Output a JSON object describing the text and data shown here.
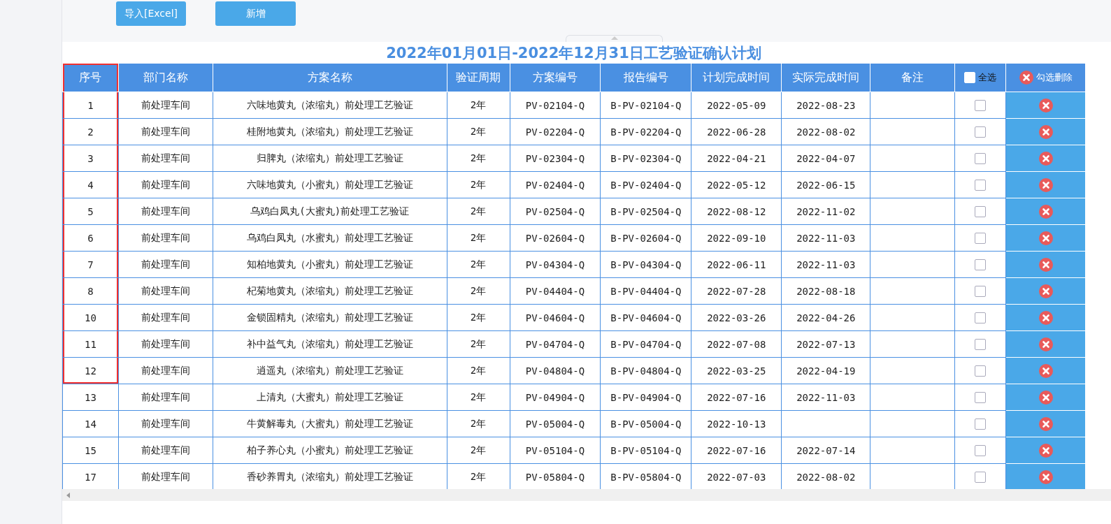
{
  "toolbar": {
    "buttons": [
      {
        "label": "导入[Excel]"
      },
      {
        "label": "新增"
      }
    ]
  },
  "title": "2022年01月01日-2022年12月31日工艺验证确认计划",
  "table": {
    "columns": [
      {
        "kind": "text",
        "label": "序号"
      },
      {
        "kind": "text",
        "label": "部门名称"
      },
      {
        "kind": "text",
        "label": "方案名称"
      },
      {
        "kind": "text",
        "label": "验证周期"
      },
      {
        "kind": "text",
        "label": "方案编号"
      },
      {
        "kind": "text",
        "label": "报告编号"
      },
      {
        "kind": "text",
        "label": "计划完成时间"
      },
      {
        "kind": "text",
        "label": "实际完成时间"
      },
      {
        "kind": "text",
        "label": "备注"
      },
      {
        "kind": "select-all",
        "label": "全选",
        "checked": false
      },
      {
        "kind": "delete",
        "label": "勾选删除"
      }
    ],
    "rows": [
      {
        "cells": [
          "1",
          "前处理车间",
          "六味地黄丸（浓缩丸）前处理工艺验证",
          "2年",
          "PV-02104-Q",
          "B-PV-02104-Q",
          "2022-05-09",
          "2022-08-23"
        ],
        "checked": false,
        "highlighted": true
      },
      {
        "cells": [
          "2",
          "前处理车间",
          "桂附地黄丸（浓缩丸）前处理工艺验证",
          "2年",
          "PV-02204-Q",
          "B-PV-02204-Q",
          "2022-06-28",
          "2022-08-02"
        ],
        "checked": false,
        "highlighted": true
      },
      {
        "cells": [
          "3",
          "前处理车间",
          "归脾丸（浓缩丸）前处理工艺验证",
          "2年",
          "PV-02304-Q",
          "B-PV-02304-Q",
          "2022-04-21",
          "2022-04-07"
        ],
        "checked": false,
        "highlighted": true
      },
      {
        "cells": [
          "4",
          "前处理车间",
          "六味地黄丸（小蜜丸）前处理工艺验证",
          "2年",
          "PV-02404-Q",
          "B-PV-02404-Q",
          "2022-05-12",
          "2022-06-15"
        ],
        "checked": false,
        "highlighted": true
      },
      {
        "cells": [
          "5",
          "前处理车间",
          "乌鸡白凤丸(大蜜丸)前处理工艺验证",
          "2年",
          "PV-02504-Q",
          "B-PV-02504-Q",
          "2022-08-12",
          "2022-11-02"
        ],
        "checked": false,
        "highlighted": true
      },
      {
        "cells": [
          "6",
          "前处理车间",
          "乌鸡白凤丸（水蜜丸）前处理工艺验证",
          "2年",
          "PV-02604-Q",
          "B-PV-02604-Q",
          "2022-09-10",
          "2022-11-03"
        ],
        "checked": false,
        "highlighted": true
      },
      {
        "cells": [
          "7",
          "前处理车间",
          "知柏地黄丸（小蜜丸）前处理工艺验证",
          "2年",
          "PV-04304-Q",
          "B-PV-04304-Q",
          "2022-06-11",
          "2022-11-03"
        ],
        "checked": false,
        "highlighted": true
      },
      {
        "cells": [
          "8",
          "前处理车间",
          "杞菊地黄丸（浓缩丸）前处理工艺验证",
          "2年",
          "PV-04404-Q",
          "B-PV-04404-Q",
          "2022-07-28",
          "2022-08-18"
        ],
        "checked": false,
        "highlighted": true
      },
      {
        "cells": [
          "10",
          "前处理车间",
          "金锁固精丸（浓缩丸）前处理工艺验证",
          "2年",
          "PV-04604-Q",
          "B-PV-04604-Q",
          "2022-03-26",
          "2022-04-26"
        ],
        "checked": false,
        "highlighted": true
      },
      {
        "cells": [
          "11",
          "前处理车间",
          "补中益气丸（浓缩丸）前处理工艺验证",
          "2年",
          "PV-04704-Q",
          "B-PV-04704-Q",
          "2022-07-08",
          "2022-07-13"
        ],
        "checked": false,
        "highlighted": true
      },
      {
        "cells": [
          "12",
          "前处理车间",
          "逍遥丸（浓缩丸）前处理工艺验证",
          "2年",
          "PV-04804-Q",
          "B-PV-04804-Q",
          "2022-03-25",
          "2022-04-19"
        ],
        "checked": false,
        "highlighted": true
      },
      {
        "cells": [
          "13",
          "前处理车间",
          "上清丸（大蜜丸）前处理工艺验证",
          "2年",
          "PV-04904-Q",
          "B-PV-04904-Q",
          "2022-07-16",
          "2022-11-03"
        ],
        "checked": false,
        "highlighted": false
      },
      {
        "cells": [
          "14",
          "前处理车间",
          "牛黄解毒丸（大蜜丸）前处理工艺验证",
          "2年",
          "PV-05004-Q",
          "B-PV-05004-Q",
          "2022-10-13",
          ""
        ],
        "checked": false,
        "highlighted": false
      },
      {
        "cells": [
          "15",
          "前处理车间",
          "柏子养心丸（小蜜丸）前处理工艺验证",
          "2年",
          "PV-05104-Q",
          "B-PV-05104-Q",
          "2022-07-16",
          "2022-07-14"
        ],
        "checked": false,
        "highlighted": false
      },
      {
        "cells": [
          "17",
          "前处理车间",
          "香砂养胃丸（浓缩丸）前处理工艺验证",
          "2年",
          "PV-05804-Q",
          "B-PV-05804-Q",
          "2022-07-03",
          "2022-08-02"
        ],
        "checked": false,
        "highlighted": false
      }
    ]
  }
}
